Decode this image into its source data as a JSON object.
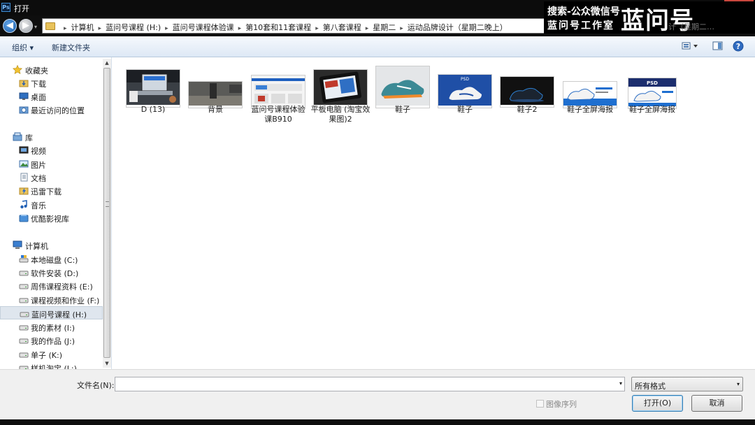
{
  "window": {
    "title": "打开",
    "app_icon": "Ps",
    "close_glyph": "✕"
  },
  "nav": {
    "back_glyph": "◀",
    "forward_glyph": "▶",
    "history_glyph": "▾"
  },
  "address": {
    "crumbs": [
      "计算机",
      "蓝问号课程 (H:)",
      "蓝问号课程体验课",
      "第10套和11套课程",
      "第八套课程",
      "星期二",
      "运动品牌设计（星期二晚上）"
    ],
    "sep_glyph": "▸"
  },
  "watermark": {
    "line1": "搜索-公众微信号",
    "line2": "蓝问号工作室",
    "big": "蓝问号",
    "faded": "计（星期二…"
  },
  "toolbar": {
    "organize": "组织 ▾",
    "new_folder": "新建文件夹"
  },
  "sidebar": {
    "items": [
      {
        "label": "收藏夹",
        "icon": "star-icon",
        "head": true
      },
      {
        "label": "下载",
        "icon": "download-folder-icon"
      },
      {
        "label": "桌面",
        "icon": "desktop-icon"
      },
      {
        "label": "最近访问的位置",
        "icon": "recent-places-icon"
      },
      {
        "label": "库",
        "icon": "library-icon",
        "head": true
      },
      {
        "label": "视频",
        "icon": "video-library-icon"
      },
      {
        "label": "图片",
        "icon": "pictures-library-icon"
      },
      {
        "label": "文档",
        "icon": "documents-library-icon"
      },
      {
        "label": "迅雷下载",
        "icon": "thunder-download-icon"
      },
      {
        "label": "音乐",
        "icon": "music-library-icon"
      },
      {
        "label": "优酷影视库",
        "icon": "youku-library-icon"
      },
      {
        "label": "计算机",
        "icon": "computer-icon",
        "head": true
      },
      {
        "label": "本地磁盘 (C:)",
        "icon": "system-drive-icon"
      },
      {
        "label": "软件安装 (D:)",
        "icon": "drive-icon"
      },
      {
        "label": "周伟课程资料 (E:)",
        "icon": "drive-icon"
      },
      {
        "label": "课程视频和作业 (F:)",
        "icon": "drive-icon"
      },
      {
        "label": "蓝问号课程 (H:)",
        "icon": "drive-icon",
        "selected": true
      },
      {
        "label": "我的素材 (I:)",
        "icon": "drive-icon"
      },
      {
        "label": "我的作品 (J:)",
        "icon": "drive-icon"
      },
      {
        "label": "单子 (K:)",
        "icon": "drive-icon"
      },
      {
        "label": "样机淘宝 (L:)",
        "icon": "drive-icon"
      }
    ]
  },
  "files": [
    {
      "name": "D (13)",
      "thumb": "laptop-mockup"
    },
    {
      "name": "背景",
      "thumb": "street-background"
    },
    {
      "name": "蓝问号课程体验课B910",
      "thumb": "web-page"
    },
    {
      "name": "平板电脑 (淘宝效果图)2",
      "thumb": "tablet-mockup"
    },
    {
      "name": "鞋子",
      "thumb": "sneaker-teal"
    },
    {
      "name": "鞋子",
      "thumb": "sneaker-psd-blue"
    },
    {
      "name": "鞋子2",
      "thumb": "sneaker-dark"
    },
    {
      "name": "鞋子全屏海报",
      "thumb": "sneaker-poster"
    },
    {
      "name": "鞋子全屏海报",
      "thumb": "sneaker-poster-psd"
    }
  ],
  "thumb_text": {
    "psd": "PSD"
  },
  "footer": {
    "filename_label": "文件名(N):",
    "filename_value": "",
    "filetype": "所有格式",
    "dropdown_glyph": "▾",
    "image_sequence": "图像序列",
    "open": "打开(O)",
    "cancel": "取消"
  }
}
